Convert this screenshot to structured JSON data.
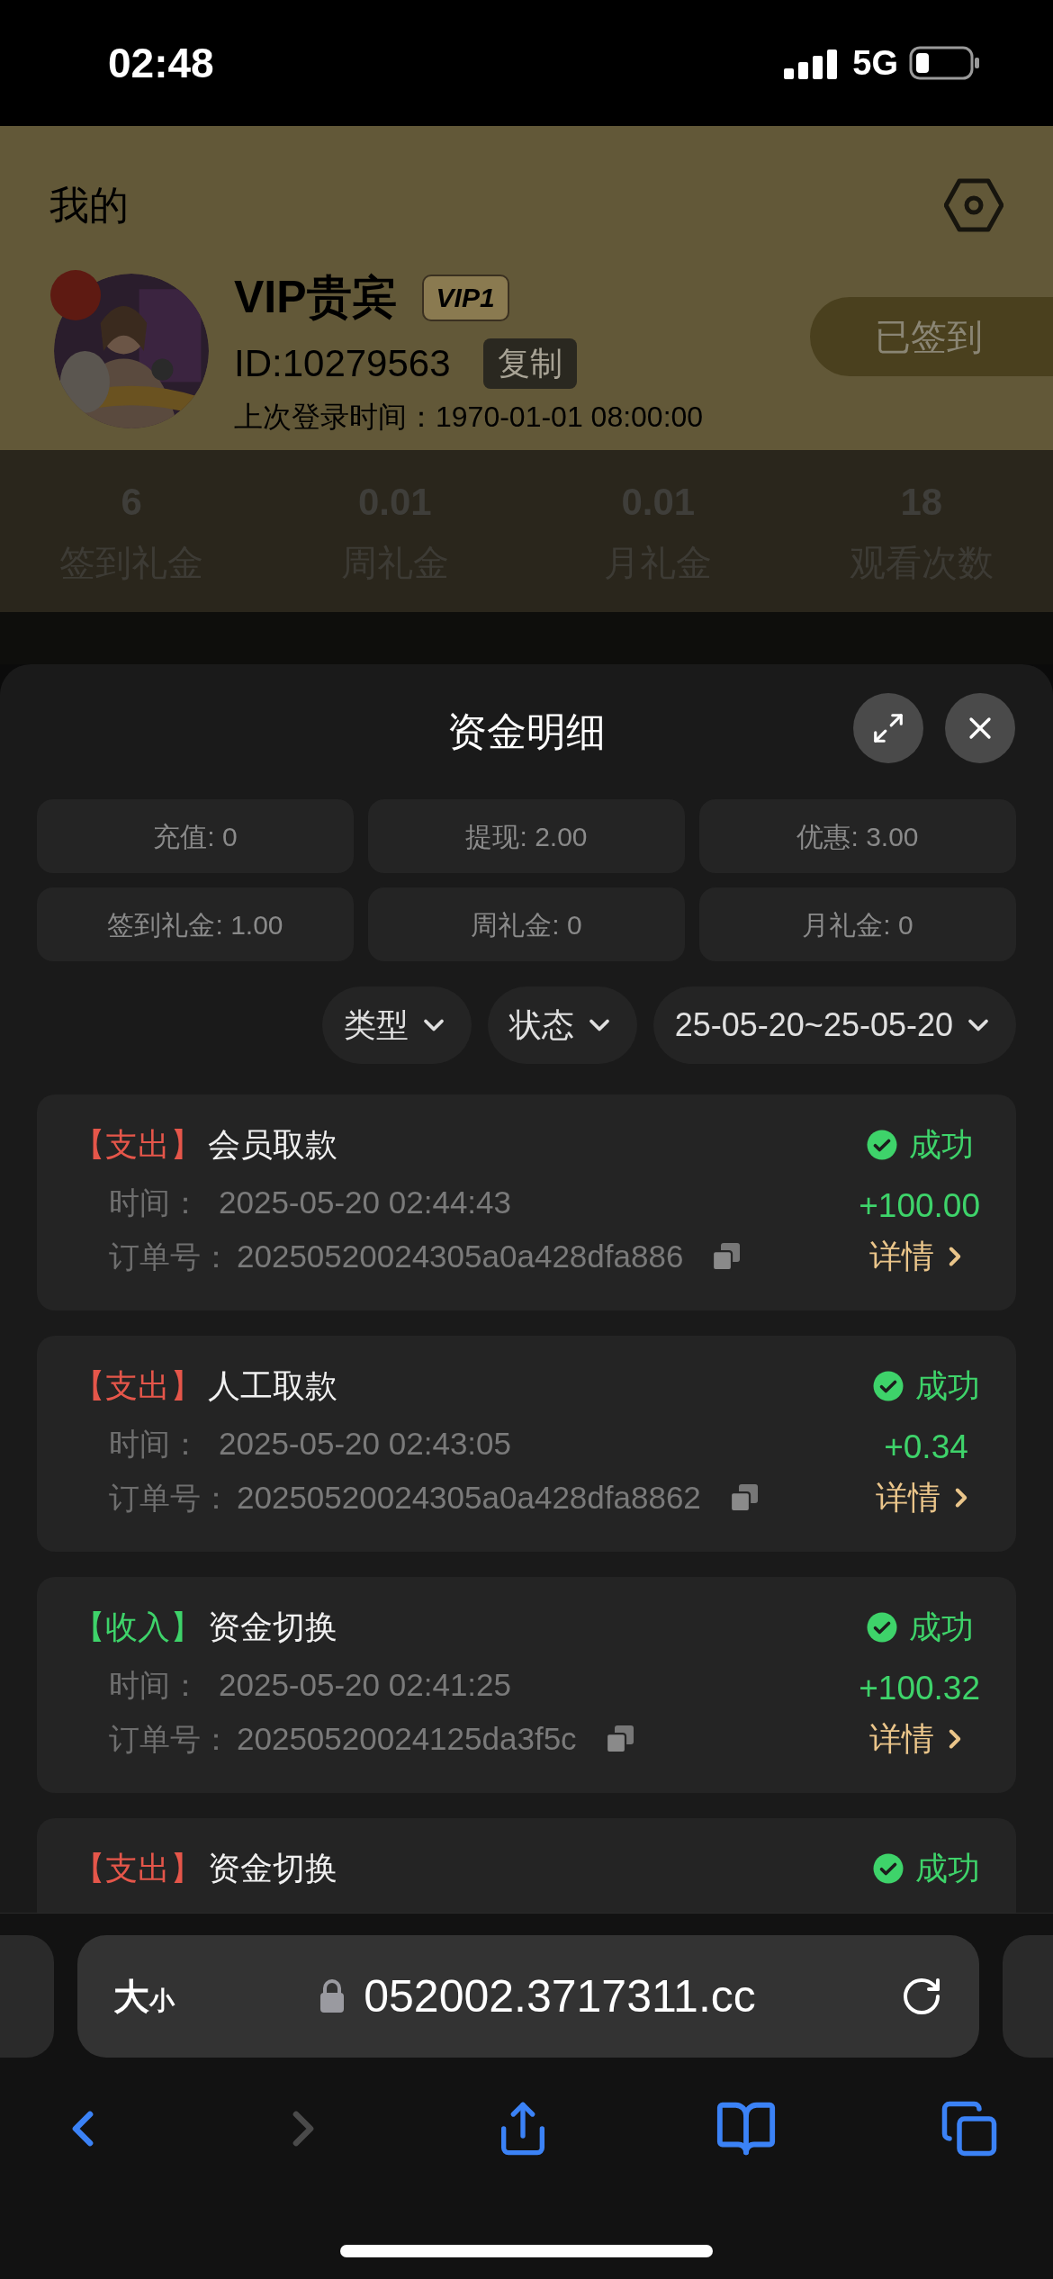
{
  "status_bar": {
    "time": "02:48",
    "network": "5G"
  },
  "header": {
    "title": "我的"
  },
  "profile": {
    "name": "VIP贵宾",
    "vip_badge": "VIP1",
    "id": "ID:10279563",
    "copy_button": "复制",
    "last_login": "上次登录时间：1970-01-01 08:00:00",
    "checkin_button": "已签到"
  },
  "stats": [
    {
      "value": "6",
      "label": "签到礼金"
    },
    {
      "value": "0.01",
      "label": "周礼金"
    },
    {
      "value": "0.01",
      "label": "月礼金"
    },
    {
      "value": "18",
      "label": "观看次数"
    }
  ],
  "sheet": {
    "title": "资金明细",
    "summary": [
      "充值: 0",
      "提现: 2.00",
      "优惠: 3.00",
      "签到礼金: 1.00",
      "周礼金: 0",
      "月礼金: 0"
    ],
    "filters": [
      "类型",
      "状态",
      "25-05-20~25-05-20"
    ],
    "records": [
      {
        "kind": "expense",
        "tag": "【支出】",
        "title": "会员取款",
        "time_label": "时间：",
        "time": "2025-05-20 02:44:43",
        "order_label": "订单号：",
        "order": "20250520024305a0a428dfa886",
        "status": "成功",
        "amount": "+100.00",
        "detail": "详情"
      },
      {
        "kind": "expense",
        "tag": "【支出】",
        "title": "人工取款",
        "time_label": "时间：",
        "time": "2025-05-20 02:43:05",
        "order_label": "订单号：",
        "order": "20250520024305a0a428dfa8862",
        "status": "成功",
        "amount": "+0.34",
        "detail": "详情"
      },
      {
        "kind": "income",
        "tag": "【收入】",
        "title": "资金切换",
        "time_label": "时间：",
        "time": "2025-05-20 02:41:25",
        "order_label": "订单号：",
        "order": "20250520024125da3f5c",
        "status": "成功",
        "amount": "+100.32",
        "detail": "详情"
      },
      {
        "kind": "expense",
        "tag": "【支出】",
        "title": "资金切换",
        "status": "成功"
      }
    ]
  },
  "browser": {
    "size_large": "大",
    "size_small": "小",
    "url": "052002.3717311.cc",
    "forward_disabled": true
  }
}
